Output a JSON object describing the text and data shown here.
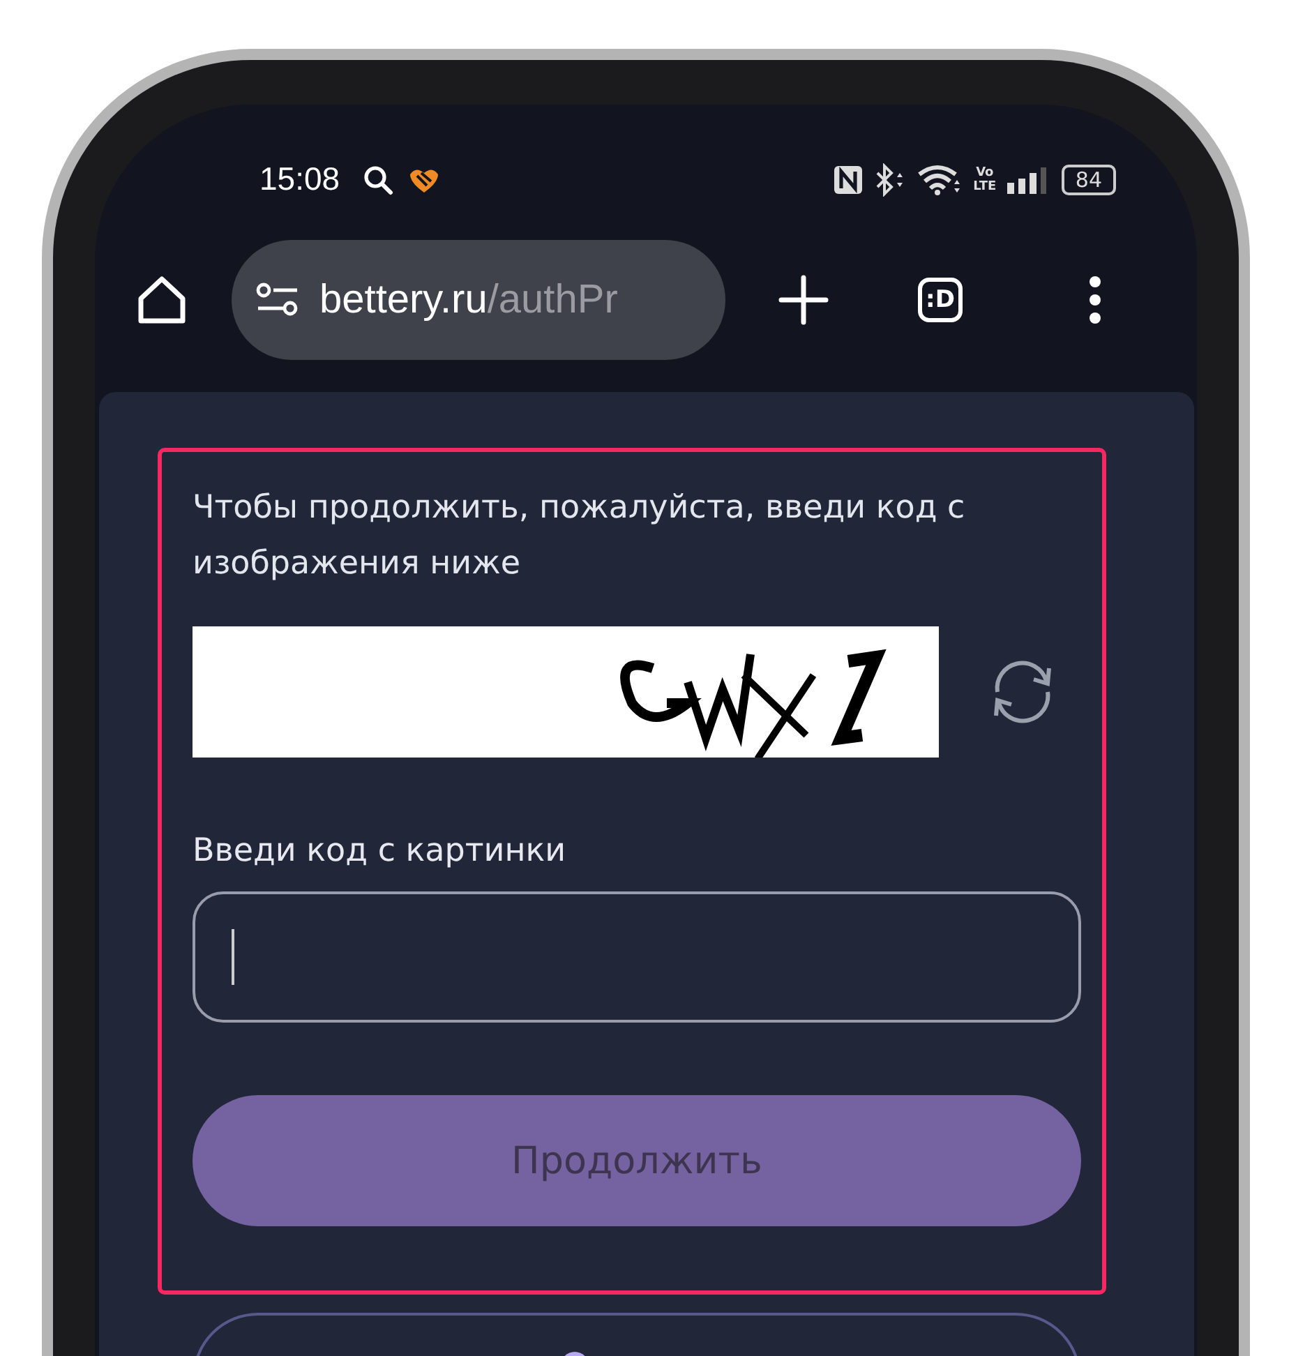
{
  "status_bar": {
    "time": "15:08",
    "network": "Vo LTE",
    "battery": "84"
  },
  "browser": {
    "url_host": "bettery.ru",
    "url_path": "/authPr",
    "tabs_label": ":D"
  },
  "captcha_form": {
    "highlighted": true,
    "prompt": "Чтобы продолжить, пожалуйста, введи код с изображения ниже",
    "code_label": "Введи код с картинки",
    "code_field": {
      "focused": true
    },
    "submit": {
      "label": "Продолжить",
      "disabled": true
    }
  }
}
